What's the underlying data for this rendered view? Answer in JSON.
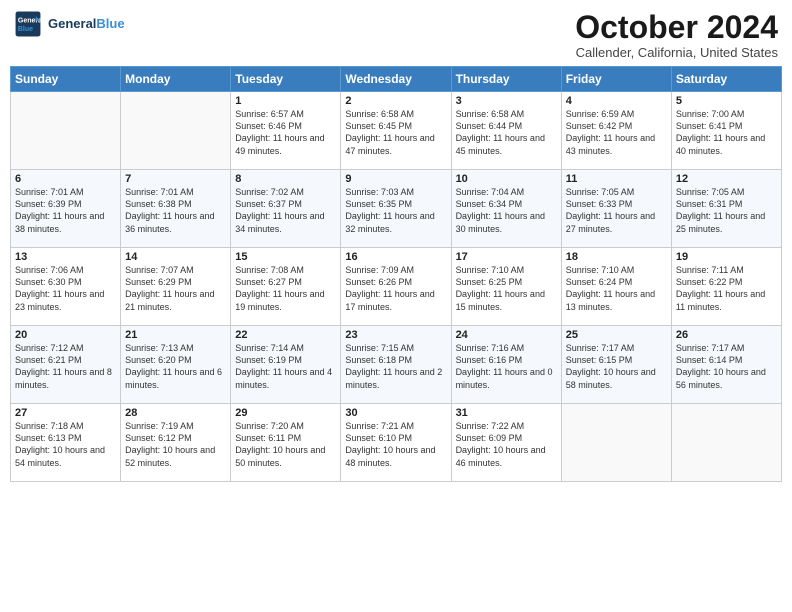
{
  "header": {
    "logo_line1": "General",
    "logo_line2": "Blue",
    "month": "October 2024",
    "location": "Callender, California, United States"
  },
  "days_of_week": [
    "Sunday",
    "Monday",
    "Tuesday",
    "Wednesday",
    "Thursday",
    "Friday",
    "Saturday"
  ],
  "weeks": [
    [
      {
        "num": "",
        "info": ""
      },
      {
        "num": "",
        "info": ""
      },
      {
        "num": "1",
        "info": "Sunrise: 6:57 AM\nSunset: 6:46 PM\nDaylight: 11 hours and 49 minutes."
      },
      {
        "num": "2",
        "info": "Sunrise: 6:58 AM\nSunset: 6:45 PM\nDaylight: 11 hours and 47 minutes."
      },
      {
        "num": "3",
        "info": "Sunrise: 6:58 AM\nSunset: 6:44 PM\nDaylight: 11 hours and 45 minutes."
      },
      {
        "num": "4",
        "info": "Sunrise: 6:59 AM\nSunset: 6:42 PM\nDaylight: 11 hours and 43 minutes."
      },
      {
        "num": "5",
        "info": "Sunrise: 7:00 AM\nSunset: 6:41 PM\nDaylight: 11 hours and 40 minutes."
      }
    ],
    [
      {
        "num": "6",
        "info": "Sunrise: 7:01 AM\nSunset: 6:39 PM\nDaylight: 11 hours and 38 minutes."
      },
      {
        "num": "7",
        "info": "Sunrise: 7:01 AM\nSunset: 6:38 PM\nDaylight: 11 hours and 36 minutes."
      },
      {
        "num": "8",
        "info": "Sunrise: 7:02 AM\nSunset: 6:37 PM\nDaylight: 11 hours and 34 minutes."
      },
      {
        "num": "9",
        "info": "Sunrise: 7:03 AM\nSunset: 6:35 PM\nDaylight: 11 hours and 32 minutes."
      },
      {
        "num": "10",
        "info": "Sunrise: 7:04 AM\nSunset: 6:34 PM\nDaylight: 11 hours and 30 minutes."
      },
      {
        "num": "11",
        "info": "Sunrise: 7:05 AM\nSunset: 6:33 PM\nDaylight: 11 hours and 27 minutes."
      },
      {
        "num": "12",
        "info": "Sunrise: 7:05 AM\nSunset: 6:31 PM\nDaylight: 11 hours and 25 minutes."
      }
    ],
    [
      {
        "num": "13",
        "info": "Sunrise: 7:06 AM\nSunset: 6:30 PM\nDaylight: 11 hours and 23 minutes."
      },
      {
        "num": "14",
        "info": "Sunrise: 7:07 AM\nSunset: 6:29 PM\nDaylight: 11 hours and 21 minutes."
      },
      {
        "num": "15",
        "info": "Sunrise: 7:08 AM\nSunset: 6:27 PM\nDaylight: 11 hours and 19 minutes."
      },
      {
        "num": "16",
        "info": "Sunrise: 7:09 AM\nSunset: 6:26 PM\nDaylight: 11 hours and 17 minutes."
      },
      {
        "num": "17",
        "info": "Sunrise: 7:10 AM\nSunset: 6:25 PM\nDaylight: 11 hours and 15 minutes."
      },
      {
        "num": "18",
        "info": "Sunrise: 7:10 AM\nSunset: 6:24 PM\nDaylight: 11 hours and 13 minutes."
      },
      {
        "num": "19",
        "info": "Sunrise: 7:11 AM\nSunset: 6:22 PM\nDaylight: 11 hours and 11 minutes."
      }
    ],
    [
      {
        "num": "20",
        "info": "Sunrise: 7:12 AM\nSunset: 6:21 PM\nDaylight: 11 hours and 8 minutes."
      },
      {
        "num": "21",
        "info": "Sunrise: 7:13 AM\nSunset: 6:20 PM\nDaylight: 11 hours and 6 minutes."
      },
      {
        "num": "22",
        "info": "Sunrise: 7:14 AM\nSunset: 6:19 PM\nDaylight: 11 hours and 4 minutes."
      },
      {
        "num": "23",
        "info": "Sunrise: 7:15 AM\nSunset: 6:18 PM\nDaylight: 11 hours and 2 minutes."
      },
      {
        "num": "24",
        "info": "Sunrise: 7:16 AM\nSunset: 6:16 PM\nDaylight: 11 hours and 0 minutes."
      },
      {
        "num": "25",
        "info": "Sunrise: 7:17 AM\nSunset: 6:15 PM\nDaylight: 10 hours and 58 minutes."
      },
      {
        "num": "26",
        "info": "Sunrise: 7:17 AM\nSunset: 6:14 PM\nDaylight: 10 hours and 56 minutes."
      }
    ],
    [
      {
        "num": "27",
        "info": "Sunrise: 7:18 AM\nSunset: 6:13 PM\nDaylight: 10 hours and 54 minutes."
      },
      {
        "num": "28",
        "info": "Sunrise: 7:19 AM\nSunset: 6:12 PM\nDaylight: 10 hours and 52 minutes."
      },
      {
        "num": "29",
        "info": "Sunrise: 7:20 AM\nSunset: 6:11 PM\nDaylight: 10 hours and 50 minutes."
      },
      {
        "num": "30",
        "info": "Sunrise: 7:21 AM\nSunset: 6:10 PM\nDaylight: 10 hours and 48 minutes."
      },
      {
        "num": "31",
        "info": "Sunrise: 7:22 AM\nSunset: 6:09 PM\nDaylight: 10 hours and 46 minutes."
      },
      {
        "num": "",
        "info": ""
      },
      {
        "num": "",
        "info": ""
      }
    ]
  ]
}
